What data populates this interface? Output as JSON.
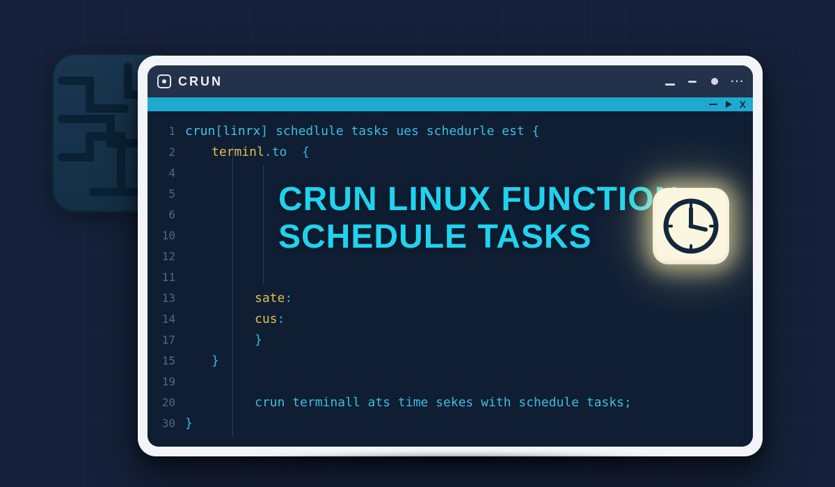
{
  "app": {
    "title": "CRUN"
  },
  "ribbon": {
    "dash_label": "collapse",
    "play_label": "run",
    "close_label": "close"
  },
  "window_controls": {
    "minimize": "minimize",
    "restore": "restore",
    "dot": "maximize",
    "more": "more"
  },
  "headline": {
    "line1": "CRUN LINUX FUNCTION",
    "line2": "SCHEDULE TASKS"
  },
  "gutter_numbers": [
    "1",
    "2",
    "4",
    "5",
    "6",
    "10",
    "12",
    "11",
    "13",
    "14",
    "17",
    "15",
    "19",
    "20",
    "30"
  ],
  "code_lines": {
    "l1_pre": "crun",
    "l1_bracket_word": "linrx",
    "l1_rest": " schedlule tasks ues schedurle est {",
    "l2_key": "terminl",
    "l2_punc": ".to  {",
    "l3": "",
    "l4": "",
    "l5": "",
    "l6": "",
    "l7": "",
    "l8": "",
    "l9_key": "sate",
    "l9_punc": ":",
    "l10_key": "cus",
    "l10_punc": ":",
    "l11_close1": "}",
    "l12_close2": "}",
    "l13": "",
    "l14": "crun terminall ats time sekes with schedule tasks;",
    "l15_close3": "}"
  },
  "clock_icon": "clock-icon"
}
